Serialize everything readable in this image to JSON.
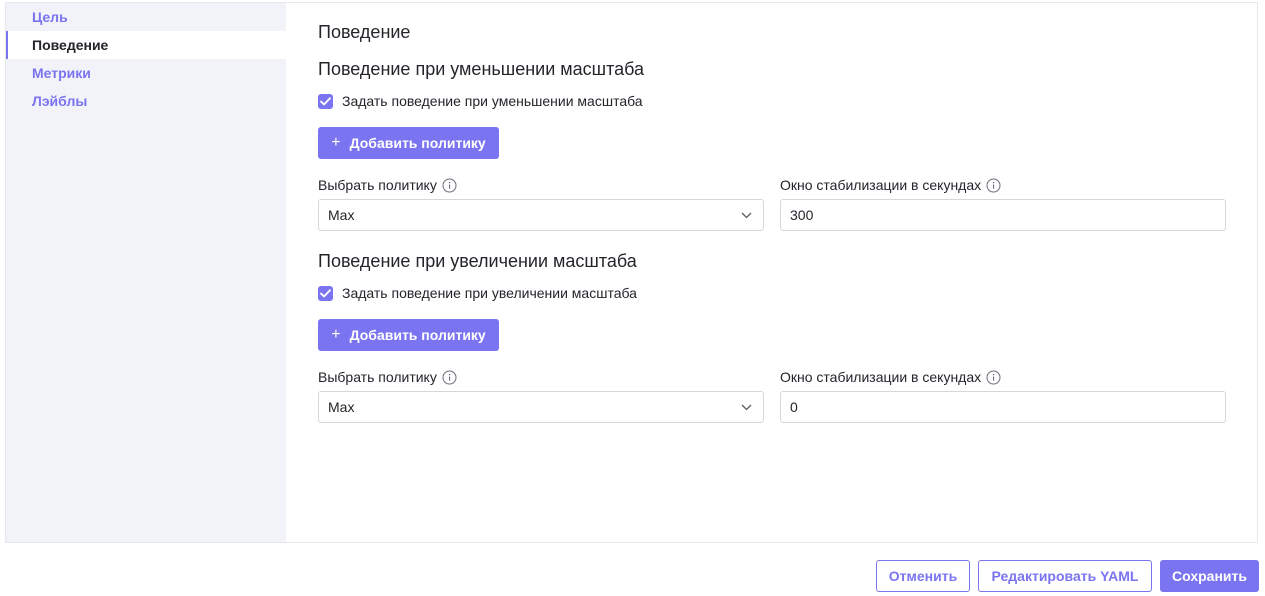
{
  "sidebar": {
    "items": [
      {
        "label": "Цель"
      },
      {
        "label": "Поведение"
      },
      {
        "label": "Метрики"
      },
      {
        "label": "Лэйблы"
      }
    ],
    "active_index": 1
  },
  "main": {
    "title": "Поведение",
    "scale_down": {
      "heading": "Поведение при уменьшении масштаба",
      "checkbox_label": "Задать поведение при уменьшении масштаба",
      "checked": true,
      "add_policy_label": "Добавить политику",
      "policy_label": "Выбрать политику",
      "policy_value": "Max",
      "window_label": "Окно стабилизации в секундах",
      "window_value": "300"
    },
    "scale_up": {
      "heading": "Поведение при увеличении масштаба",
      "checkbox_label": "Задать поведение при увеличении масштаба",
      "checked": true,
      "add_policy_label": "Добавить политику",
      "policy_label": "Выбрать политику",
      "policy_value": "Max",
      "window_label": "Окно стабилизации в секундах",
      "window_value": "0"
    }
  },
  "footer": {
    "cancel_label": "Отменить",
    "edit_yaml_label": "Редактировать YAML",
    "save_label": "Сохранить"
  },
  "colors": {
    "accent": "#7b74f0",
    "sidebar_bg": "#f1f3f8",
    "text": "#24252b",
    "border": "#d5d7de"
  },
  "icons": {
    "checkbox": "check-icon",
    "info": "info-icon",
    "select": "chevron-down-icon",
    "add": "plus-icon"
  }
}
